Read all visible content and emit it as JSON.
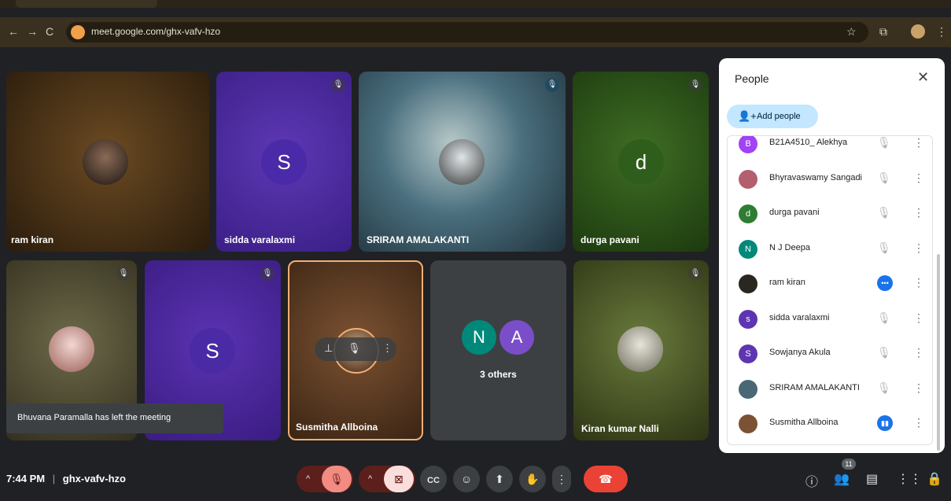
{
  "browser": {
    "url": "meet.google.com/ghx-vafv-hzo"
  },
  "tiles": [
    {
      "name": "ram kiran",
      "bg": "#3b2a14"
    },
    {
      "name": "sidda varalaxmi",
      "letter": "S",
      "bg": "#4b2a9e"
    },
    {
      "name": "SRIRAM AMALAKANTI",
      "bg": "#3a6270"
    },
    {
      "name": "durga pavani",
      "letter": "d",
      "bg": "#2c5a1b"
    },
    {
      "name": "",
      "bg": "#4a4a33"
    },
    {
      "name": "",
      "letter": "S",
      "bg": "#4a2597"
    },
    {
      "name": "Susmitha Allboina",
      "bg": "#6e4424"
    },
    {
      "others_label": "3 others",
      "letters": [
        "N",
        "A"
      ]
    },
    {
      "name": "Kiran kumar Nalli",
      "bg": "#4a5529"
    }
  ],
  "toast": "Bhuvana Paramalla has left the meeting",
  "meeting": {
    "time": "7:44 PM",
    "separator": "|",
    "code": "ghx-vafv-hzo"
  },
  "controls": {
    "icons": [
      "chevron-up",
      "mic-off",
      "chevron-up",
      "camera-off",
      "captions",
      "emoji",
      "present",
      "raise-hand",
      "more-options",
      "end-call"
    ]
  },
  "right_controls": {
    "participant_count": "11",
    "icons": [
      "info",
      "people",
      "chat",
      "activities",
      "host-controls"
    ]
  },
  "people_panel": {
    "title": "People",
    "add_people": "Add people",
    "participants": [
      {
        "name": "B21A4510_ Alekhya",
        "avatar": "B",
        "color": "#a142f4",
        "status": "muted"
      },
      {
        "name": "Bhyravaswamy Sangadi",
        "avatar": "",
        "color": "#b35f6f",
        "status": "muted"
      },
      {
        "name": "durga pavani",
        "avatar": "d",
        "color": "#2e7d32",
        "status": "muted"
      },
      {
        "name": "N J Deepa",
        "avatar": "N",
        "color": "#00897b",
        "status": "muted"
      },
      {
        "name": "ram kiran",
        "avatar": "",
        "color": "#2a2620",
        "status": "dots"
      },
      {
        "name": "sidda varalaxmi",
        "avatar": "s",
        "color": "#5e35b1",
        "status": "muted"
      },
      {
        "name": "Sowjanya Akula",
        "avatar": "S",
        "color": "#5e35b1",
        "status": "muted"
      },
      {
        "name": "SRIRAM AMALAKANTI",
        "avatar": "",
        "color": "#4a6775",
        "status": "muted"
      },
      {
        "name": "Susmitha Allboina",
        "avatar": "",
        "color": "#7b5234",
        "status": "speaking"
      }
    ]
  }
}
